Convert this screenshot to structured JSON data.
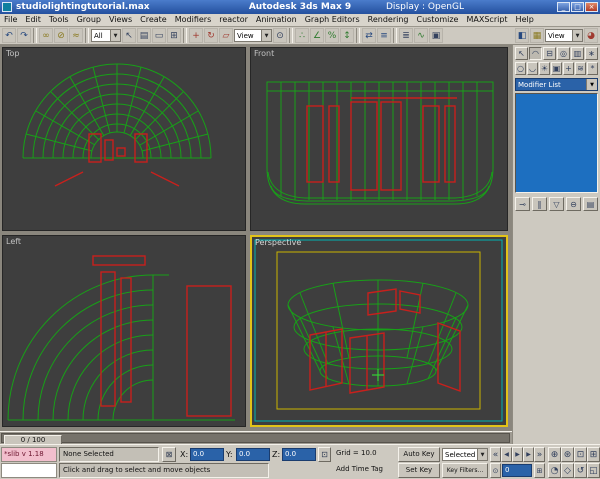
{
  "colors": {
    "wireframe_green": "#18a018",
    "wireframe_red": "#c8201c",
    "active_viewport_border": "#e2c318",
    "safe_frame_teal": "#00b4b4",
    "safe_frame_yellow": "#c9b400",
    "modifier_stack_blue": "#1d6fc0",
    "value_field_blue": "#2a62a8",
    "titlebar_blue": "#24509e"
  },
  "title_bar": {
    "document": "studiolightingtutorial.max",
    "app_title": "Autodesk 3ds Max 9",
    "display_mode": "Display : OpenGL"
  },
  "menu_bar": {
    "items": [
      "File",
      "Edit",
      "Tools",
      "Group",
      "Views",
      "Create",
      "Modifiers",
      "reactor",
      "Animation",
      "Graph Editors",
      "Rendering",
      "Customize",
      "MAXScript",
      "Help"
    ]
  },
  "toolbar": {
    "selection_filter": "All",
    "reference_coordinate": "View",
    "render_type": "View"
  },
  "viewports": {
    "top_label": "Top",
    "front_label": "Front",
    "left_label": "Left",
    "perspective_label": "Perspective"
  },
  "command_panel": {
    "modifier_list": "Modifier List"
  },
  "time_slider": {
    "label": "0 / 100"
  },
  "status_bar": {
    "selection_status": "None Selected",
    "prompt": "Click and drag to select and move objects",
    "x_label": "X:",
    "y_label": "Y:",
    "z_label": "Z:",
    "x_value": "0.0",
    "y_value": "0.0",
    "z_value": "0.0",
    "grid_label": "Grid = 10.0",
    "add_time_tag": "Add Time Tag"
  },
  "animation_controls": {
    "auto_key": "Auto Key",
    "set_key": "Set Key",
    "key_mode": "Selected",
    "key_filters": "Key Filters...",
    "current_frame": "0"
  },
  "maxscript_listener": {
    "text": "*slib v 1.18"
  },
  "icons": {
    "minimize": "_",
    "maximize": "□",
    "close": "×",
    "dropdown_arrow": "▼",
    "undo": "↶",
    "redo": "↷",
    "select_link": "∞",
    "unlink_selection": "⊘",
    "bind_to_space_warp": "≈",
    "select_object": "↖",
    "select_by_name": "▤",
    "selection_region": "▭",
    "window_crossing": "⊞",
    "select_and_move": "+",
    "select_and_rotate": "↻",
    "select_and_scale": "▱",
    "use_pivot_point": "⊙",
    "snaps_toggle": "∴",
    "angle_snap": "∠",
    "percent_snap": "%",
    "spinner_snap": "↕",
    "mirror": "⇄",
    "align": "≡",
    "layer_manager": "≣",
    "curve_editor": "∿",
    "schematic_view": "▣",
    "material_editor": "◧",
    "render_setup": "▦",
    "quick_render": "◕",
    "tab_create": "↖",
    "tab_modify": "◠",
    "tab_hierarchy": "⊟",
    "tab_motion": "◎",
    "tab_display": "▥",
    "tab_utilities": "∗",
    "cat_geometry": "○",
    "cat_shapes": "◡",
    "cat_lights": "☀",
    "cat_cameras": "▣",
    "cat_helpers": "+",
    "cat_space_warps": "≋",
    "cat_systems": "*",
    "pin_stack": "⊸",
    "show_end_result": "‖",
    "make_unique": "▽",
    "remove_modifier": "⊖",
    "configure_modifier_sets": "▤",
    "lock_selection": "⊠",
    "absolute_mode": "⊡",
    "go_to_start": "«",
    "previous_frame": "◀",
    "play_animation": "▶",
    "next_frame": "▶",
    "go_to_end": "»",
    "key_mode_toggle": "⊙",
    "time_configuration": "⊞",
    "nav_zoom": "⊕",
    "nav_zoom_all": "⊛",
    "nav_zoom_extents": "⊡",
    "nav_zoom_extents_all": "⊞",
    "nav_field_of_view": "◔",
    "nav_pan": "◇",
    "nav_arc_rotate": "↺",
    "nav_min_max_toggle": "◱",
    "spinner_up_down": "▴▾"
  }
}
